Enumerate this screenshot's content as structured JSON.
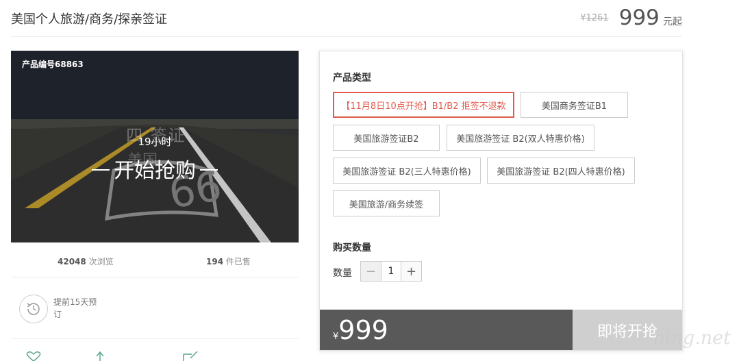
{
  "header": {
    "title": "美国个人旅游/商务/探亲签证",
    "old_price": "¥1261",
    "price": "999",
    "price_unit": "元起"
  },
  "hero": {
    "product_code": "产品编号68863",
    "watermark_line1": "四 签证",
    "watermark_line2": "美国",
    "countdown": "19小时",
    "start_buy": "开始抢购"
  },
  "stats": {
    "views_count": "42048",
    "views_label": "次浏览",
    "sold_count": "194",
    "sold_label": "件已售"
  },
  "advance": {
    "text": "提前15天预订"
  },
  "panel": {
    "type_label": "产品类型",
    "options": [
      {
        "label": "【11月8日10点开抢】B1/B2 拒签不退款",
        "selected": true
      },
      {
        "label": "美国商务签证B1",
        "selected": false
      },
      {
        "label": "美国旅游签证B2",
        "selected": false
      },
      {
        "label": "美国旅游签证 B2(双人特惠价格)",
        "selected": false
      },
      {
        "label": "美国旅游签证 B2(三人特惠价格)",
        "selected": false
      },
      {
        "label": "美国旅游签证 B2(四人特惠价格)",
        "selected": false
      },
      {
        "label": "美国旅游/商务续签",
        "selected": false
      }
    ],
    "purchase_qty_label": "购买数量",
    "qty_label": "数量",
    "qty_value": "1",
    "minus": "−",
    "plus": "+",
    "currency": "¥",
    "final_price": "999",
    "buy_button": "即将开抢"
  },
  "watermark": "ning.net",
  "colors": {
    "accent": "#e25a4b",
    "buy_bar": "#595959",
    "buy_button_disabled": "#cfcfcf"
  }
}
